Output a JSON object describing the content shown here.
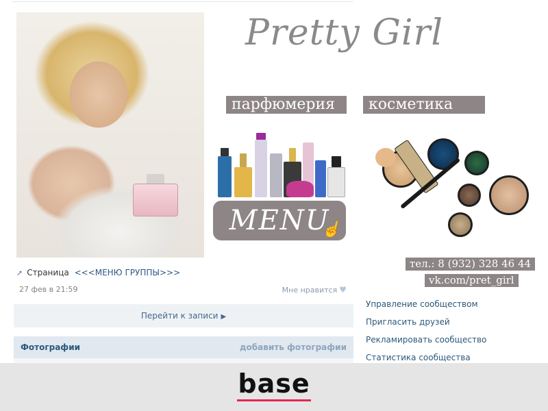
{
  "banner": {
    "logo_text": "Pretty Girl",
    "perfume_label": "парфюмерия",
    "cosmetics_label": "косметика",
    "menu_button": "MENU",
    "phone": "тел.: 8 (932) 328 46 44",
    "vk_link": "vk.com/pret_girl"
  },
  "post": {
    "page_word": "Страница",
    "link_text": "<<<МЕНЮ ГРУППЫ>>>",
    "date": "27 фев в 21:59",
    "like_label": "Мне нравится",
    "goto_label": "Перейти к записи"
  },
  "photos": {
    "title": "Фотографии",
    "add_label": "добавить фотографии"
  },
  "side_menu": [
    "Управление сообществом",
    "Пригласить друзей",
    "Рекламировать сообщество",
    "Статистика сообщества"
  ],
  "brand": {
    "name": "base",
    "accent_color": "#e2284f"
  },
  "icons": {
    "post_arrow": "arrow-icon",
    "like": "heart-icon",
    "goto": "chevron-right-icon",
    "menu_cursor": "hand-pointer-icon"
  },
  "colors": {
    "label_bg": "#8d8586",
    "link": "#2b587a",
    "bar_bg": "#eff2f5"
  }
}
